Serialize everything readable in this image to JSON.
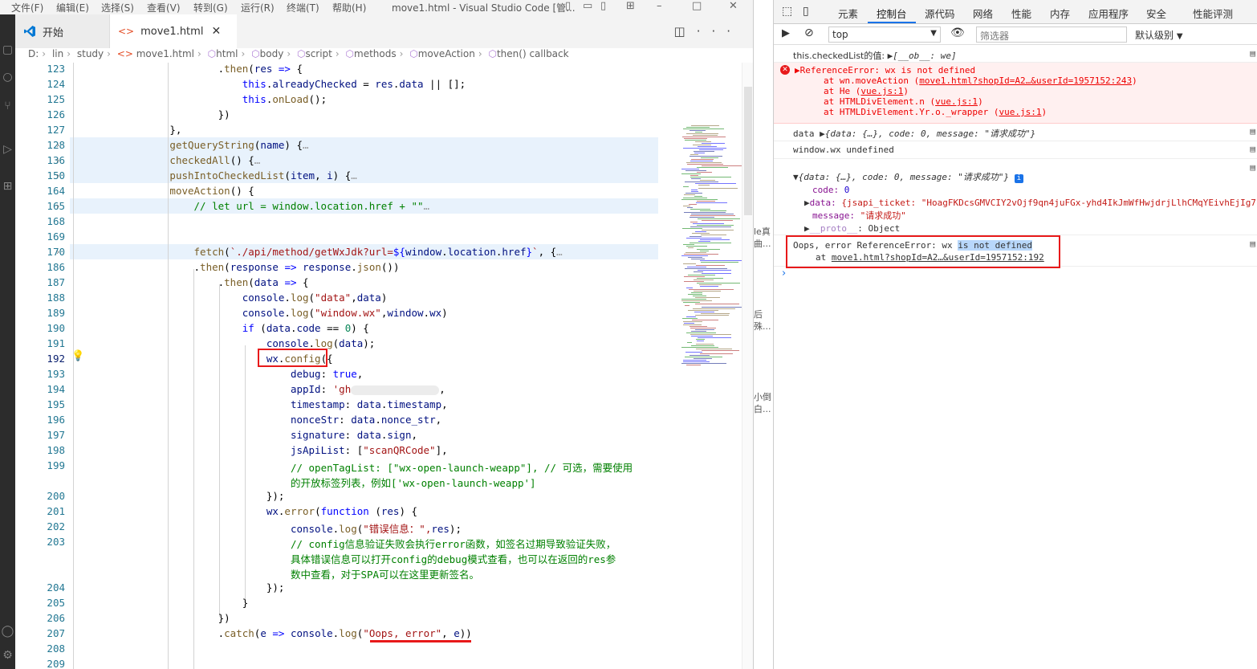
{
  "vscode": {
    "menu": [
      "文件(F)",
      "编辑(E)",
      "选择(S)",
      "查看(V)",
      "转到(G)",
      "运行(R)",
      "终端(T)",
      "帮助(H)"
    ],
    "window_title": "move1.html - Visual Studio Code [管...",
    "tabs": [
      {
        "label": "开始"
      },
      {
        "label": "move1.html"
      }
    ],
    "breadcrumb": [
      "D:",
      "lin",
      "study",
      "move1.html",
      "html",
      "body",
      "script",
      "methods",
      "moveAction",
      "then() callback"
    ],
    "line_numbers": [
      "123",
      "124",
      "125",
      "126",
      "127",
      "128",
      "136",
      "150",
      "164",
      "165",
      "168",
      "169",
      "170",
      "186",
      "187",
      "188",
      "189",
      "190",
      "191",
      "192",
      "193",
      "194",
      "195",
      "196",
      "197",
      "198",
      "199",
      "",
      "200",
      "201",
      "202",
      "203",
      "",
      "",
      "204",
      "205",
      "206",
      "207",
      "208",
      "209"
    ]
  },
  "mid_strip": [
    "le真",
    "曲...",
    "后",
    "殊...",
    "小倒",
    "白..."
  ],
  "devtools": {
    "tabs": [
      "元素",
      "控制台",
      "源代码",
      "网络",
      "性能",
      "内存",
      "应用程序",
      "安全",
      "性能评测"
    ],
    "context": "top",
    "filter_placeholder": "筛选器",
    "level": "默认级别",
    "console": {
      "l1_text": "this.checkedList的值: ",
      "l1_obj": "[__ob__: we]",
      "err_title": "ReferenceError: wx is not defined",
      "err_stack": [
        {
          "pre": "at wn.moveAction (",
          "link": "move1.html?shopId=A2…&userId=1957152:243",
          "post": ")"
        },
        {
          "pre": "at He (",
          "link": "vue.js:1",
          "post": ")"
        },
        {
          "pre": "at HTMLDivElement.n (",
          "link": "vue.js:1",
          "post": ")"
        },
        {
          "pre": "at HTMLDivElement.Yr.o._wrapper (",
          "link": "vue.js:1",
          "post": ")"
        }
      ],
      "data_label": "data ",
      "data_obj": "{data: {…}, code: 0, message: \"请求成功\"}",
      "wx_line": "window.wx undefined",
      "exp_head": "{data: {…}, code: 0, message: \"请求成功\"}",
      "exp_code_k": "code: ",
      "exp_code_v": "0",
      "exp_data_k": "data: ",
      "exp_data_v": "{jsapi_ticket: \"HoagFKDcsGMVCIY2vOjf9qn4juFGx-yhd4IkJmWfHwjdrjLlhCMqYEivhEjIg7",
      "exp_msg_k": "message: ",
      "exp_msg_v": "\"请求成功\"",
      "exp_proto_k": "__proto__",
      "exp_proto_v": ": Object",
      "oops_pre": "Oops, error ReferenceError: wx ",
      "oops_sel": "is not defined",
      "oops_at": "at ",
      "oops_link": "move1.html?shopId=A2…&userId=1957152:192"
    }
  },
  "colors": {
    "accent": "#1a73e8",
    "error": "#e8191a",
    "vscode_blue": "#0078d4"
  }
}
